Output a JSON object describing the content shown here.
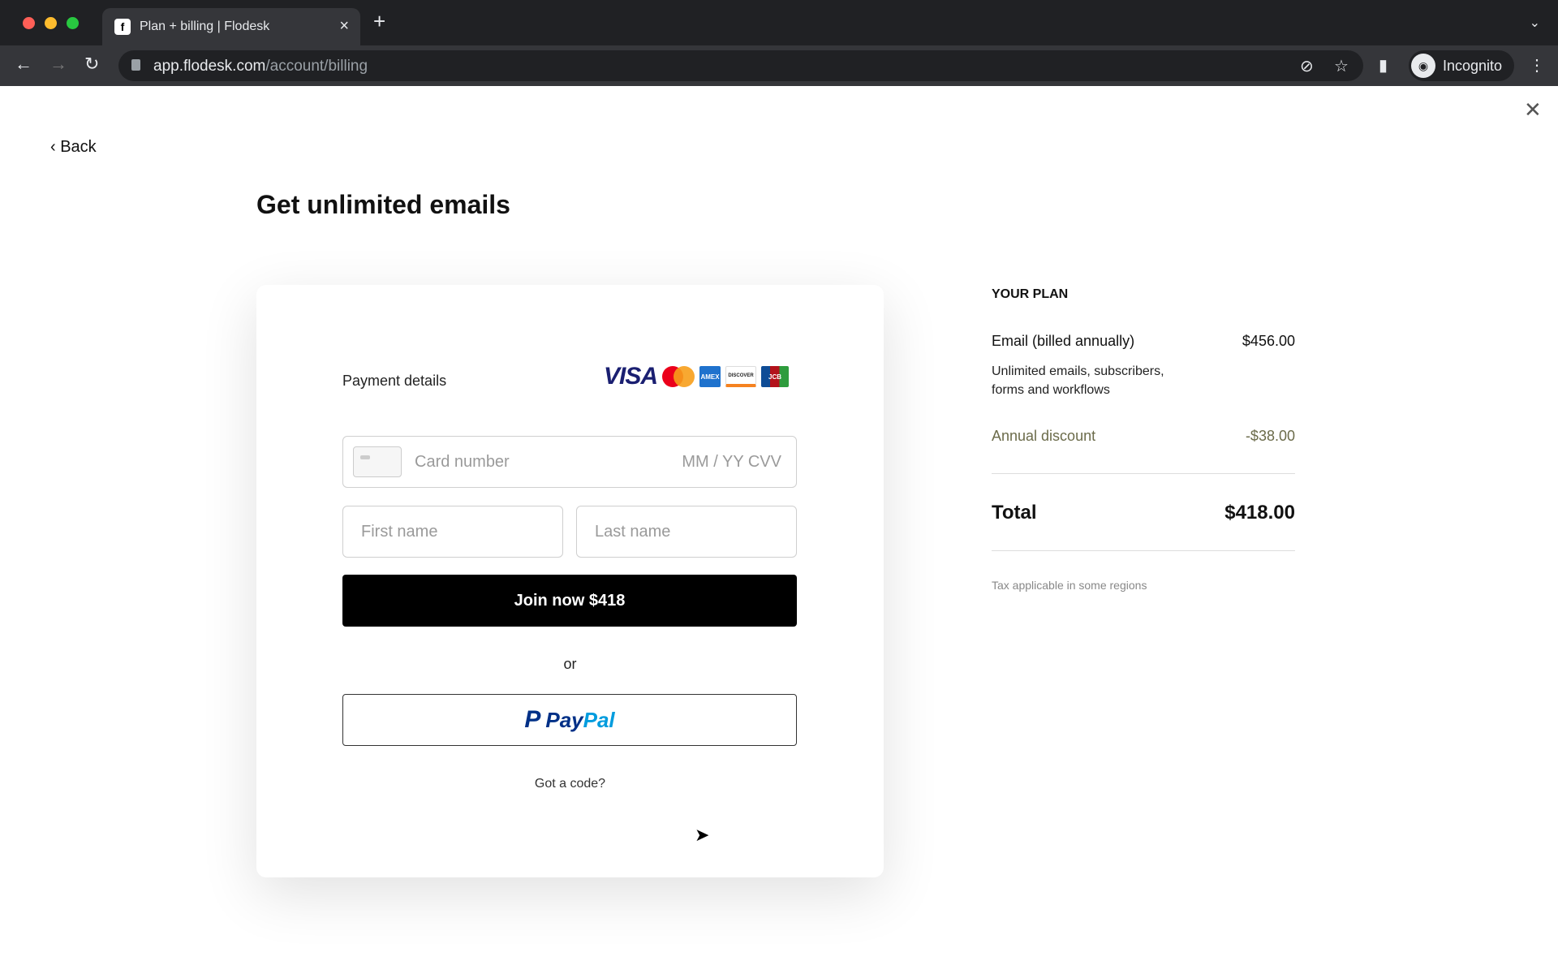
{
  "browser": {
    "tab_title": "Plan + billing | Flodesk",
    "favicon": "f",
    "url_host": "app.flodesk.com",
    "url_path": "/account/billing",
    "profile_label": "Incognito"
  },
  "page": {
    "back_label": "Back",
    "title": "Get unlimited emails"
  },
  "payment": {
    "label": "Payment details",
    "card_brands": [
      "VISA",
      "Mastercard",
      "AMEX",
      "DISCOVER",
      "JCB"
    ],
    "card_number_placeholder": "Card number",
    "expiry_cvv_placeholder": "MM / YY CVV",
    "first_name_placeholder": "First name",
    "last_name_placeholder": "Last name",
    "join_button": "Join now $418",
    "or_label": "or",
    "paypal_label_1": "Pay",
    "paypal_label_2": "Pal",
    "code_link": "Got a code?"
  },
  "plan": {
    "heading": "YOUR PLAN",
    "item_name": "Email (billed annually)",
    "item_price": "$456.00",
    "item_description": "Unlimited emails, subscribers, forms and workflows",
    "discount_label": "Annual discount",
    "discount_value": "-$38.00",
    "total_label": "Total",
    "total_value": "$418.00",
    "tax_note": "Tax applicable in some regions"
  },
  "colors": {
    "discount": "#6b6b4a",
    "primary_button": "#000000",
    "paypal_dark": "#003087",
    "paypal_light": "#009cde"
  }
}
